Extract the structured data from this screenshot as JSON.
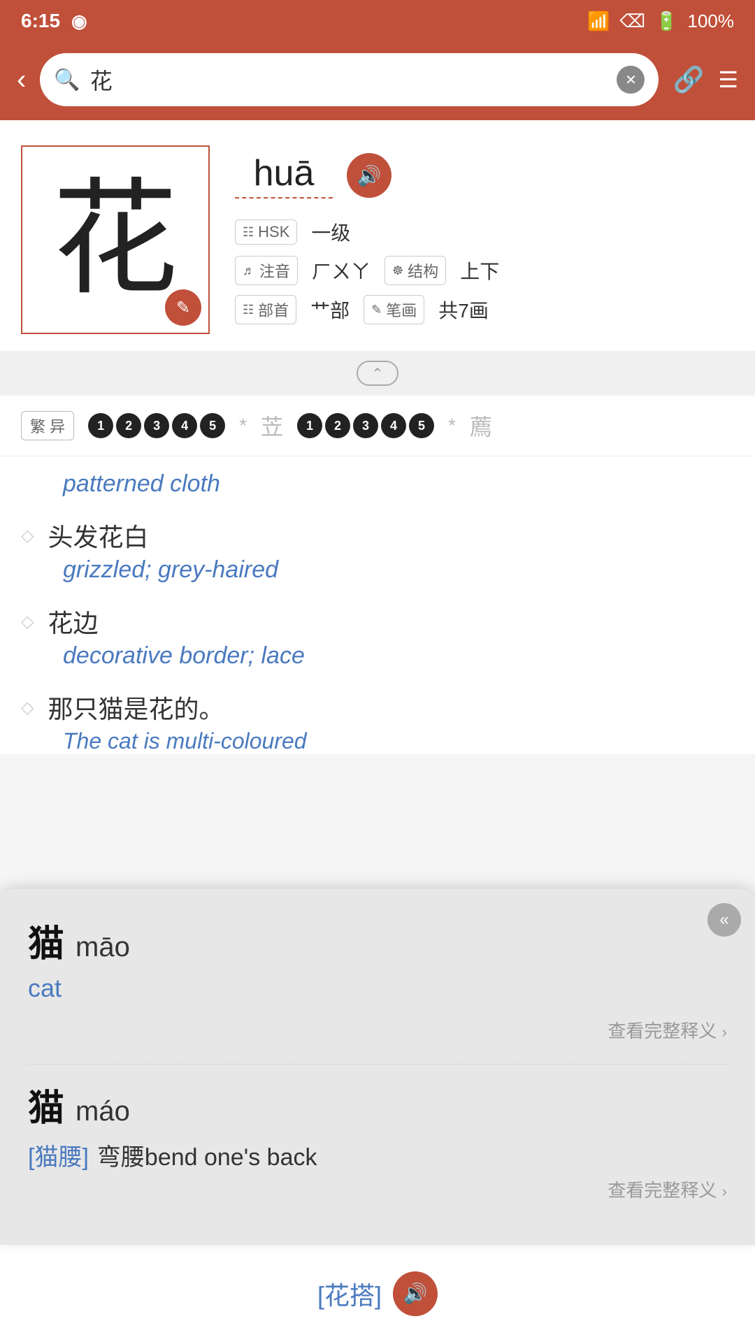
{
  "status": {
    "time": "6:15",
    "battery": "100%"
  },
  "header": {
    "search_placeholder": "花",
    "search_value": "花",
    "back_label": "‹",
    "link_icon": "🔗",
    "menu_icon": "☰",
    "clear_icon": "✕"
  },
  "character": {
    "char": "花",
    "pinyin": "huā",
    "hsk_label": "HSK",
    "hsk_level": "一级",
    "pronunciation_label": "注音",
    "pronunciation_value": "ㄏㄨㄚ",
    "structure_label": "结构",
    "structure_value": "上下",
    "radical_label": "部首",
    "radical_value": "艹部",
    "strokes_label": "笔画",
    "strokes_value": "共7画",
    "edit_icon": "✎",
    "audio_icon": "🔊"
  },
  "trad_row": {
    "label": "繁 异",
    "variant1": {
      "nums": [
        "1",
        "2",
        "3",
        "4",
        "5"
      ],
      "star": "*",
      "char": "苙"
    },
    "variant2": {
      "nums": [
        "1",
        "2",
        "3",
        "4",
        "5"
      ],
      "star": "*",
      "char": "薦"
    }
  },
  "entries": [
    {
      "english": "patterned cloth",
      "chinese": null,
      "is_phrase": false
    },
    {
      "diamond": "◇",
      "chinese": "头发花白",
      "english": "grizzled; grey-haired",
      "is_phrase": true
    },
    {
      "diamond": "◇",
      "chinese": "花边",
      "english": "decorative border; lace",
      "is_phrase": true
    },
    {
      "diamond": "◇",
      "chinese": "那只猫是花的。",
      "english": "The cat is multi-coloured",
      "is_phrase": true
    }
  ],
  "popup": {
    "entries": [
      {
        "char": "猫",
        "pinyin": "māo",
        "english": "cat",
        "see_more": "查看完整释义",
        "see_more_arrow": "›"
      },
      {
        "char": "猫",
        "pinyin": "máo",
        "phrase_bracket": "[猫腰]",
        "phrase_desc": "弯腰bend one's back",
        "see_more": "查看完整释义",
        "see_more_arrow": "›"
      }
    ],
    "close_icon": "«"
  },
  "bottom": {
    "link_text": "[花搭]",
    "audio_icon": "🔊"
  }
}
